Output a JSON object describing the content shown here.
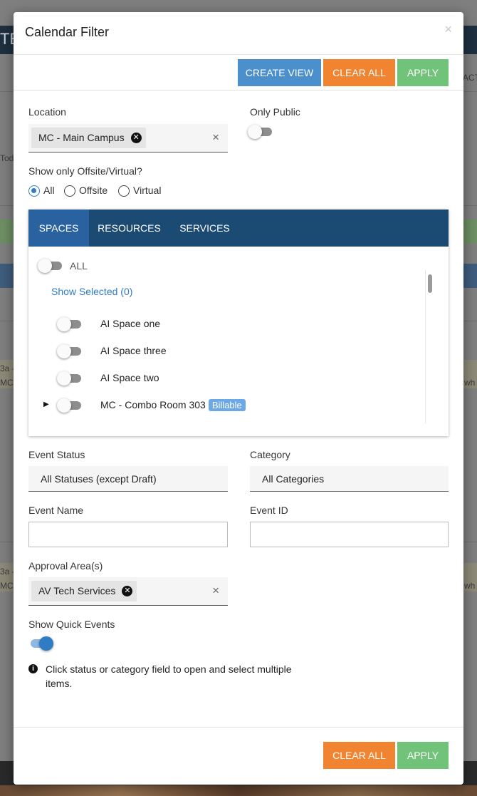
{
  "background": {
    "fragments": [
      "TE",
      "ACT",
      "Tod",
      "3a -",
      "MC",
      "wh",
      "3a -",
      "MC",
      "wh"
    ]
  },
  "modal": {
    "title": "Calendar Filter",
    "close_glyph": "×",
    "header_buttons": {
      "create_view": "CREATE VIEW",
      "clear_all": "CLEAR ALL",
      "apply": "APPLY"
    },
    "location": {
      "label": "Location",
      "chip": "MC - Main Campus",
      "clear_glyph": "×"
    },
    "only_public": {
      "label": "Only Public",
      "on": false
    },
    "offsite": {
      "label": "Show only Offsite/Virtual?",
      "options": [
        "All",
        "Offsite",
        "Virtual"
      ],
      "selected": "All"
    },
    "tabs": {
      "items": [
        "SPACES",
        "RESOURCES",
        "SERVICES"
      ],
      "active": "SPACES",
      "all_label": "ALL",
      "show_selected": "Show Selected (0)",
      "spaces": [
        {
          "name": "AI Space one",
          "badge": ""
        },
        {
          "name": "AI Space three",
          "badge": ""
        },
        {
          "name": "AI Space two",
          "badge": ""
        },
        {
          "name": "MC - Combo Room 303",
          "badge": "Billable"
        }
      ]
    },
    "event_status": {
      "label": "Event Status",
      "value": "All Statuses (except Draft)"
    },
    "category": {
      "label": "Category",
      "value": "All Categories"
    },
    "event_name": {
      "label": "Event Name",
      "value": ""
    },
    "event_id": {
      "label": "Event ID",
      "value": ""
    },
    "approval_area": {
      "label": "Approval Area(s)",
      "chip": "AV Tech Services",
      "clear_glyph": "×"
    },
    "quick_events": {
      "label": "Show Quick Events",
      "on": true
    },
    "info": {
      "icon": "i",
      "text": "Click status or category field to open and select multiple items."
    },
    "footer_buttons": {
      "clear_all": "CLEAR ALL",
      "apply": "APPLY"
    }
  },
  "colors": {
    "create_view": "#4b90cc",
    "clear_all": "#f08430",
    "apply": "#72c37a",
    "tab_bar": "#1b4a72",
    "tab_active": "#2a62a0",
    "badge": "#6aa8e8"
  }
}
